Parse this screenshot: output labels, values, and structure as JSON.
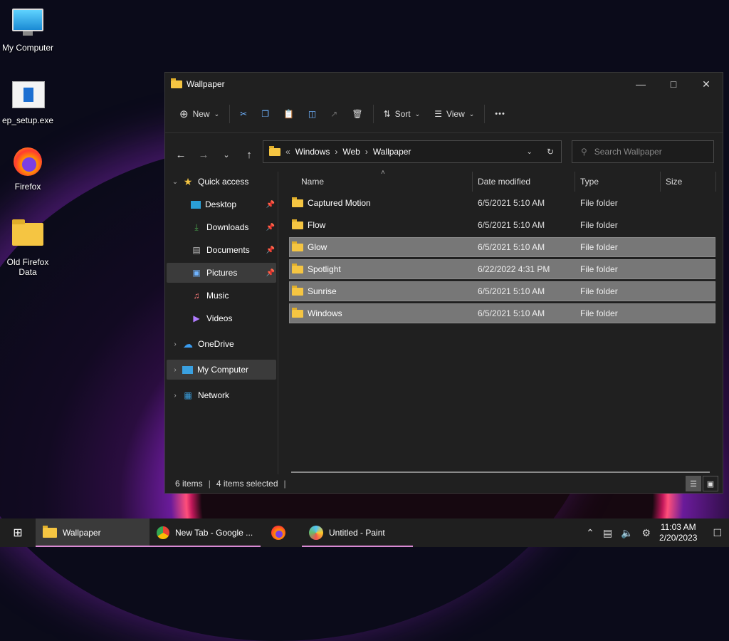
{
  "desktop": {
    "icons": [
      {
        "label": "My Computer"
      },
      {
        "label": "ep_setup.exe"
      },
      {
        "label": "Firefox"
      },
      {
        "label": "Old Firefox Data"
      }
    ]
  },
  "window": {
    "title": "Wallpaper",
    "toolbar": {
      "new_label": "New",
      "sort_label": "Sort",
      "view_label": "View",
      "more_label": "•••"
    },
    "address": {
      "crumbs": [
        "Windows",
        "Web",
        "Wallpaper"
      ]
    },
    "search": {
      "placeholder": "Search Wallpaper"
    },
    "nav": {
      "quick_access": "Quick access",
      "items": [
        {
          "label": "Desktop"
        },
        {
          "label": "Downloads"
        },
        {
          "label": "Documents"
        },
        {
          "label": "Pictures"
        },
        {
          "label": "Music"
        },
        {
          "label": "Videos"
        }
      ],
      "onedrive": "OneDrive",
      "my_computer": "My Computer",
      "network": "Network"
    },
    "columns": {
      "name": "Name",
      "date": "Date modified",
      "type": "Type",
      "size": "Size"
    },
    "rows": [
      {
        "name": "Captured Motion",
        "date": "6/5/2021 5:10 AM",
        "type": "File folder",
        "selected": false
      },
      {
        "name": "Flow",
        "date": "6/5/2021 5:10 AM",
        "type": "File folder",
        "selected": false
      },
      {
        "name": "Glow",
        "date": "6/5/2021 5:10 AM",
        "type": "File folder",
        "selected": true
      },
      {
        "name": "Spotlight",
        "date": "6/22/2022 4:31 PM",
        "type": "File folder",
        "selected": true
      },
      {
        "name": "Sunrise",
        "date": "6/5/2021 5:10 AM",
        "type": "File folder",
        "selected": true
      },
      {
        "name": "Windows",
        "date": "6/5/2021 5:10 AM",
        "type": "File folder",
        "selected": true
      }
    ],
    "status": {
      "count": "6 items",
      "selected": "4 items selected"
    }
  },
  "taskbar": {
    "items": [
      {
        "label": "Wallpaper"
      },
      {
        "label": "New Tab - Google ..."
      },
      {
        "label": ""
      },
      {
        "label": "Untitled - Paint"
      }
    ],
    "time": "11:03 AM",
    "date": "2/20/2023"
  }
}
